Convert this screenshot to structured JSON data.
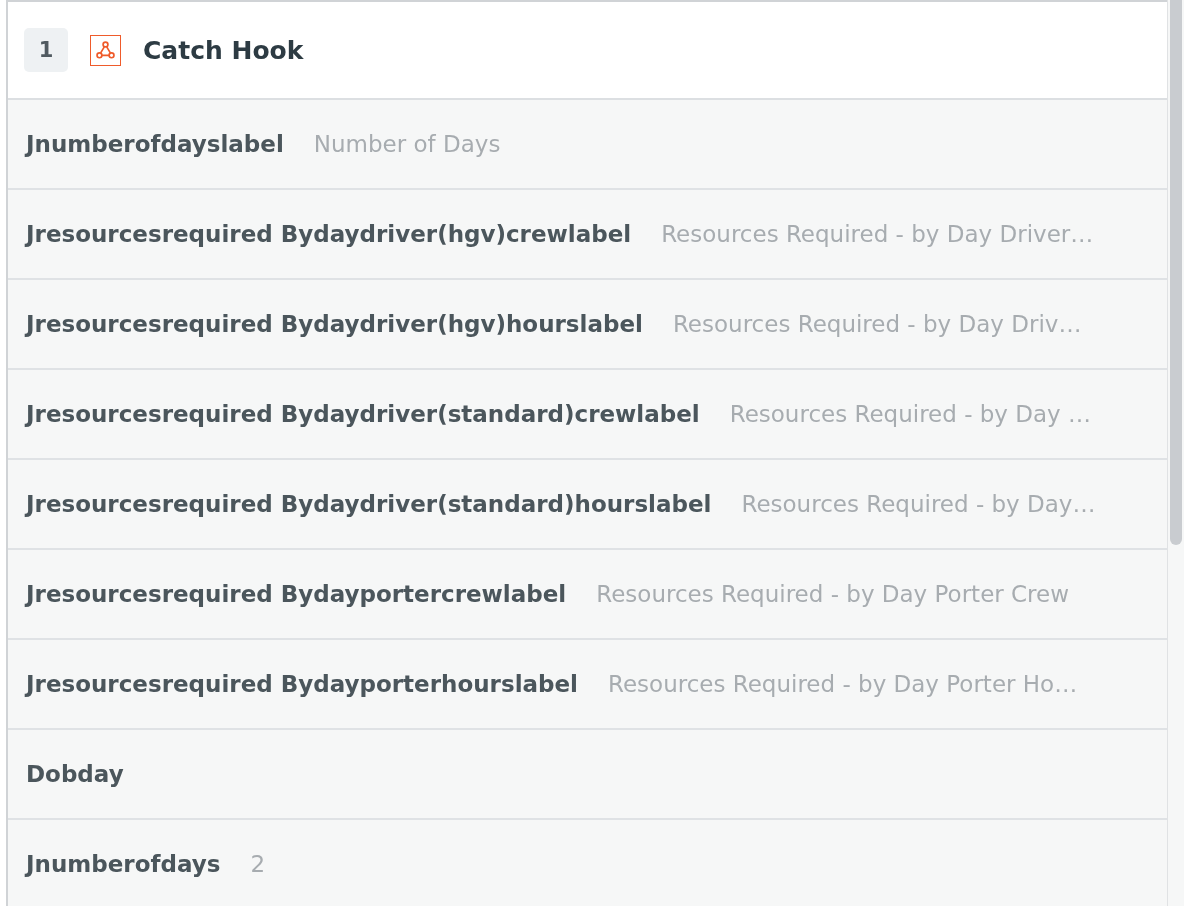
{
  "step": {
    "number": "1",
    "title": "Catch Hook"
  },
  "fields": [
    {
      "key": "Jnumberofdayslabel",
      "value": "Number of Days"
    },
    {
      "key": "Jresourcesrequired Bydaydriver(hgv)crewlabel",
      "value": "Resources Required - by Day Driver…"
    },
    {
      "key": "Jresourcesrequired Bydaydriver(hgv)hourslabel",
      "value": "Resources Required - by Day Driv…"
    },
    {
      "key": "Jresourcesrequired Bydaydriver(standard)crewlabel",
      "value": "Resources Required - by Day …"
    },
    {
      "key": "Jresourcesrequired Bydaydriver(standard)hourslabel",
      "value": "Resources Required - by Day…"
    },
    {
      "key": "Jresourcesrequired Bydayportercrewlabel",
      "value": "Resources Required - by Day Porter Crew"
    },
    {
      "key": "Jresourcesrequired Bydayporterhourslabel",
      "value": "Resources Required - by Day Porter Ho…"
    },
    {
      "key": "Dobday"
    },
    {
      "key": "Jnumberofdays",
      "value": "2"
    }
  ]
}
